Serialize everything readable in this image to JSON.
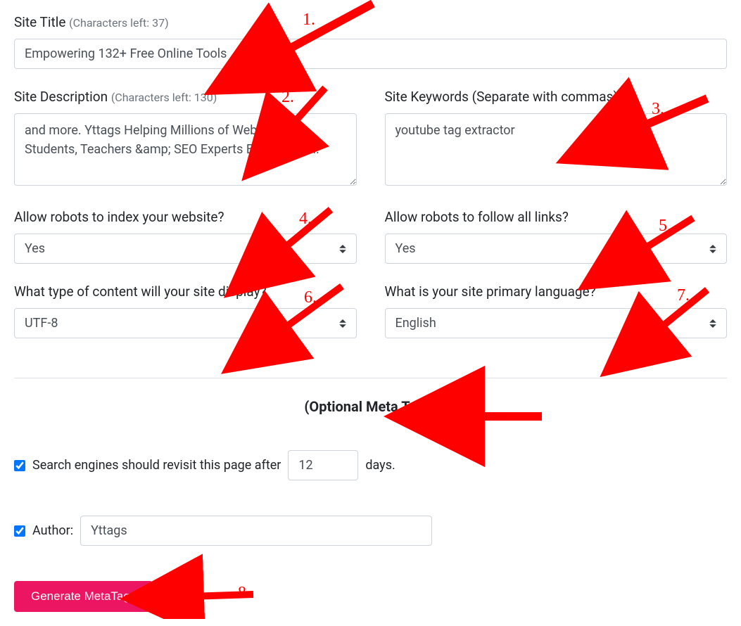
{
  "form": {
    "siteTitle": {
      "label": "Site Title",
      "charsLeftLabel": "(Characters left: 37)",
      "value": "Empowering 132+ Free Online Tools"
    },
    "siteDescription": {
      "label": "Site Description",
      "charsLeftLabel": "(Characters left: 130)",
      "value": "and more. Yttags Helping Millions of Webmasters, Students, Teachers &amp; SEO Experts Every Month."
    },
    "siteKeywords": {
      "label": "Site Keywords (Separate with commas)",
      "value": "youtube tag extractor"
    },
    "robotsIndex": {
      "label": "Allow robots to index your website?",
      "value": "Yes"
    },
    "robotsFollow": {
      "label": "Allow robots to follow all links?",
      "value": "Yes"
    },
    "contentType": {
      "label": "What type of content will your site display?",
      "value": "UTF-8"
    },
    "language": {
      "label": "What is your site primary language?",
      "value": "English"
    },
    "optionalHeading": "(Optional Meta Tags)",
    "revisit": {
      "labelPrefix": "Search engines should revisit this page after",
      "value": "12",
      "labelSuffix": "days."
    },
    "author": {
      "label": "Author:",
      "value": "Yttags"
    },
    "generateButton": "Generate MetaTags"
  },
  "annotations": {
    "a1": "1.",
    "a2": "2.",
    "a3": "3.",
    "a4": "4.",
    "a5": "5.",
    "a6": "6.",
    "a7": "7.",
    "a8": "8."
  }
}
